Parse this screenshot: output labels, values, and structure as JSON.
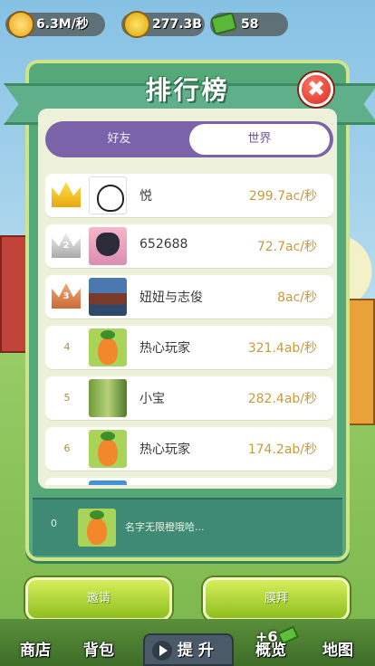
{
  "hud": {
    "rate": "6.3M/秒",
    "coins": "277.3B",
    "cash": "58"
  },
  "modal": {
    "title": "排行榜",
    "close_label": "✖",
    "tabs": [
      {
        "label": "好友",
        "active": false
      },
      {
        "label": "世界",
        "active": true
      }
    ],
    "rows": [
      {
        "rank": "1",
        "medal": "gold",
        "avatar": "bunny",
        "name": "悦",
        "score": "299.7ac/秒"
      },
      {
        "rank": "2",
        "medal": "silver",
        "avatar": "cat",
        "name": "652688",
        "score": "72.7ac/秒"
      },
      {
        "rank": "3",
        "medal": "bronze",
        "avatar": "photo",
        "name": "妞妞与志俊",
        "score": "8ac/秒"
      },
      {
        "rank": "4",
        "medal": "",
        "avatar": "carrot",
        "name": "热心玩家",
        "score": "321.4ab/秒"
      },
      {
        "rank": "5",
        "medal": "",
        "avatar": "forest",
        "name": "小宝",
        "score": "282.4ab/秒"
      },
      {
        "rank": "6",
        "medal": "",
        "avatar": "carrot",
        "name": "热心玩家",
        "score": "174.2ab/秒"
      }
    ],
    "my_row": {
      "rank": "0",
      "avatar": "carrot",
      "name": "名字无限橙哦哈..."
    }
  },
  "buttons": {
    "invite": "邀请",
    "worship": "膜拜"
  },
  "bottom_bar": {
    "shop": "商店",
    "bag": "背包",
    "upgrade": "提 升",
    "overview": "概览",
    "map": "地图",
    "reward": "+6"
  },
  "colors": {
    "modal_green": "#55a878",
    "tab_purple": "#7b63a9",
    "score_gold": "#c99a3a",
    "button_lime": "#a8d42c",
    "close_red": "#d8291c"
  }
}
